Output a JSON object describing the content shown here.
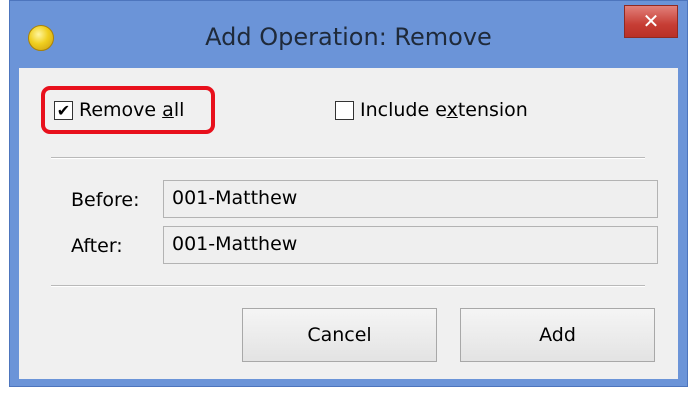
{
  "window": {
    "title": "Add Operation: Remove",
    "close_glyph": "✕"
  },
  "options": {
    "remove_all": {
      "label_pre": "Remove ",
      "label_mnemonic": "a",
      "label_post": "ll",
      "checked": true,
      "check_glyph": "✔"
    },
    "include_extension": {
      "label_pre": "Include e",
      "label_mnemonic": "x",
      "label_post": "tension",
      "checked": false
    }
  },
  "preview": {
    "before_label": "Before:",
    "before_value": "001-Matthew",
    "after_label": "After:",
    "after_value": "001-Matthew"
  },
  "buttons": {
    "cancel": "Cancel",
    "add": "Add"
  },
  "colors": {
    "titlebar": "#6b94d8",
    "close_button": "#c63d34",
    "highlight": "#e8101c"
  }
}
